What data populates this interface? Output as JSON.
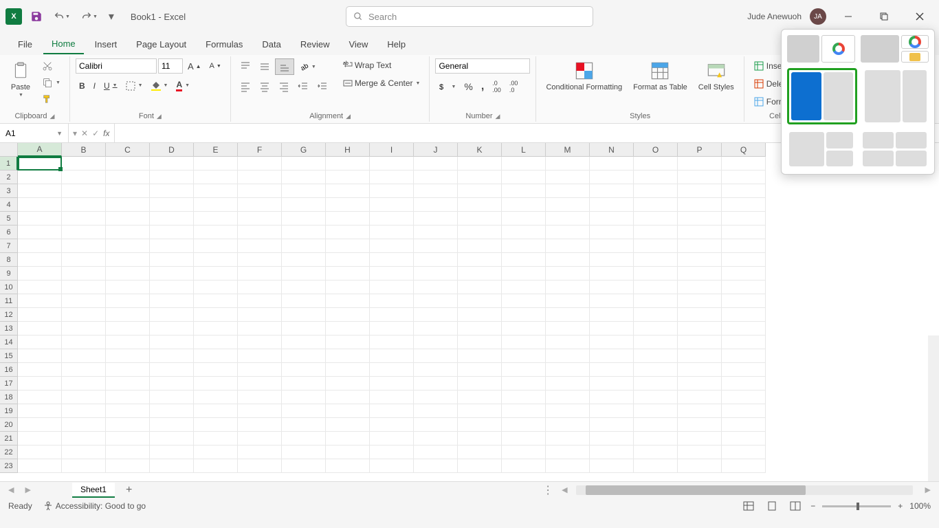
{
  "titlebar": {
    "doc_title": "Book1 - Excel",
    "search_placeholder": "Search",
    "user_name": "Jude Anewuoh",
    "user_initials": "JA"
  },
  "tabs": {
    "file": "File",
    "home": "Home",
    "insert": "Insert",
    "page_layout": "Page Layout",
    "formulas": "Formulas",
    "data": "Data",
    "review": "Review",
    "view": "View",
    "help": "Help"
  },
  "ribbon": {
    "clipboard": {
      "label": "Clipboard",
      "paste": "Paste"
    },
    "font": {
      "label": "Font",
      "name": "Calibri",
      "size": "11",
      "bold": "B",
      "italic": "I",
      "underline": "U"
    },
    "alignment": {
      "label": "Alignment",
      "wrap": "Wrap Text",
      "merge": "Merge & Center"
    },
    "number": {
      "label": "Number",
      "format": "General"
    },
    "styles": {
      "label": "Styles",
      "conditional": "Conditional Formatting",
      "table": "Format as Table",
      "cell": "Cell Styles"
    },
    "cells": {
      "label": "Cells",
      "insert": "Insert",
      "delete": "Delete",
      "format": "Format"
    }
  },
  "formula_bar": {
    "name_box": "A1",
    "fx": "fx"
  },
  "columns": [
    "A",
    "B",
    "C",
    "D",
    "E",
    "F",
    "G",
    "H",
    "I",
    "J",
    "K",
    "L",
    "M",
    "N",
    "O",
    "P",
    "Q"
  ],
  "rows": [
    "1",
    "2",
    "3",
    "4",
    "5",
    "6",
    "7",
    "8",
    "9",
    "10",
    "11",
    "12",
    "13",
    "14",
    "15",
    "16",
    "17",
    "18",
    "19",
    "20",
    "21",
    "22",
    "23"
  ],
  "sheet_tabs": {
    "sheet1": "Sheet1"
  },
  "status": {
    "ready": "Ready",
    "accessibility": "Accessibility: Good to go",
    "zoom": "100%"
  }
}
